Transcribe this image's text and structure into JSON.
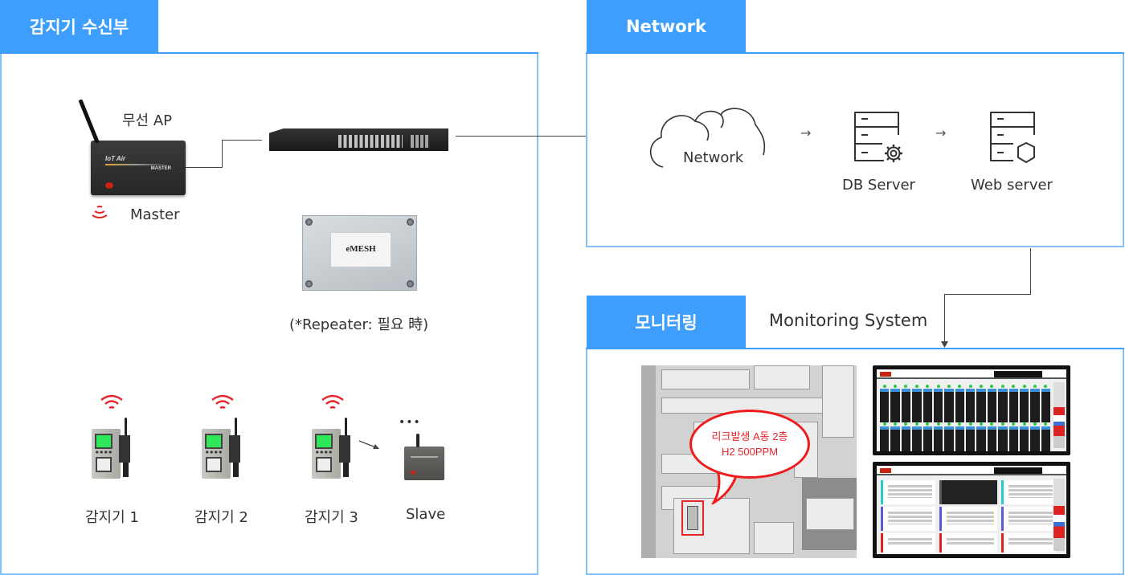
{
  "sections": {
    "receiver": {
      "tab_label": "감지기 수신부",
      "wireless_ap_label": "무선 AP",
      "master_label": "Master",
      "ap_device": {
        "brand": "IoT Air",
        "model_tag": "MASTER"
      },
      "repeater_device": {
        "sticker_text": "eMESH"
      },
      "repeater_caption": "(*Repeater: 필요 時)",
      "detectors": [
        {
          "label": "감지기 1"
        },
        {
          "label": "감지기 2"
        },
        {
          "label": "감지기 3"
        }
      ],
      "ellipsis": "•••",
      "slave_label": "Slave"
    },
    "network": {
      "tab_label": "Network",
      "nodes": [
        {
          "label": "Network",
          "icon": "cloud-icon"
        },
        {
          "label": "DB Server",
          "icon": "db-server-gear-icon"
        },
        {
          "label": "Web server",
          "icon": "web-server-shield-icon"
        }
      ],
      "arrow": "→"
    },
    "monitoring": {
      "tab_label": "모니터링",
      "subtitle": "Monitoring System",
      "alert": {
        "line1": "리크발생 A동 2층",
        "line2": "H2 500PPM"
      }
    }
  },
  "colors": {
    "accent": "#3d9efd",
    "panel_border": "#85c1fb",
    "alert_red": "#e8232a",
    "wifi_red": "#e8232a"
  }
}
